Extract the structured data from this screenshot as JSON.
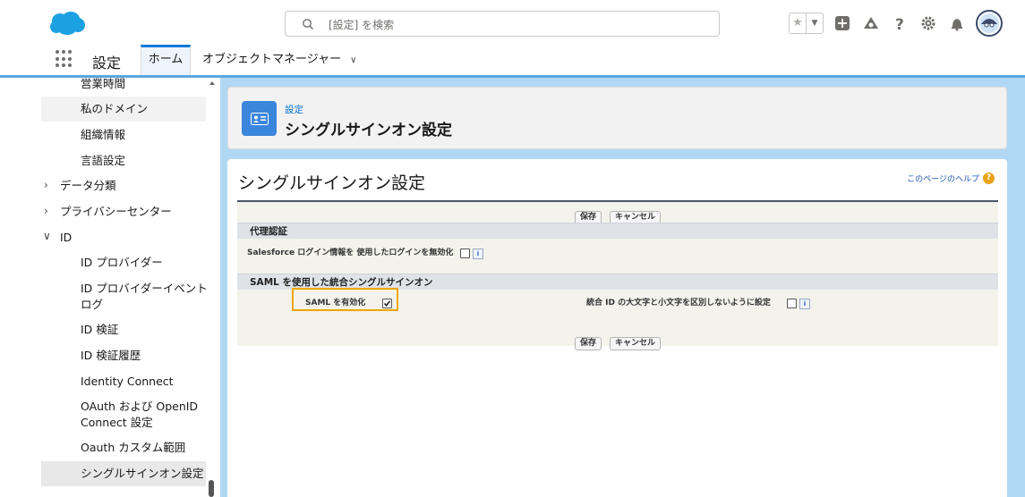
{
  "header": {
    "search_placeholder": "[設定] を検索",
    "icons": [
      "salesforce-cloud-logo",
      "search-icon",
      "favorite-star-icon",
      "favorites-dropdown-icon",
      "global-add-icon",
      "trailhead-icon",
      "help-icon",
      "setup-gear-icon",
      "notification-bell-icon",
      "user-avatar"
    ],
    "brand_color": "#1ba1e2"
  },
  "nav": {
    "app_name": "設定",
    "tabs": [
      {
        "label": "ホーム"
      },
      {
        "label": "オブジェクトマネージャー"
      }
    ]
  },
  "sidebar": {
    "items": [
      {
        "label": "営業時間"
      },
      {
        "label": "私のドメイン"
      },
      {
        "label": "組織情報"
      },
      {
        "label": "言語設定"
      },
      {
        "label": "データ分類"
      },
      {
        "label": "プライバシーセンター"
      },
      {
        "label": "ID"
      },
      {
        "label": "ID プロバイダー"
      },
      {
        "label": "ID プロバイダーイベント"
      },
      {
        "label": "ログ"
      },
      {
        "label": "ID 検証"
      },
      {
        "label": "ID 検証履歴"
      },
      {
        "label": "Identity Connect"
      },
      {
        "label": "OAuth および OpenID"
      },
      {
        "label": "Connect 設定"
      },
      {
        "label": "Oauth カスタム範囲"
      },
      {
        "label": "シングルサインオン設定"
      }
    ]
  },
  "page_header": {
    "breadcrumb": "設定",
    "title": "シングルサインオン設定"
  },
  "panel": {
    "title": "シングルサインオン設定",
    "help_link": "このページのヘルプ",
    "buttons": {
      "save": "保存",
      "cancel": "キャンセル"
    },
    "sections": {
      "delegated": "代理認証",
      "saml": "SAML を使用した統合シングルサインオン"
    },
    "fields": {
      "disable_login": "Salesforce ログイン情報を 使用したログインを無効化",
      "saml_enabled": "SAML を有効化",
      "case_insensitive": "統合 ID の大文字と小文字を区別しないように設定"
    },
    "values": {
      "disable_login": false,
      "saml_enabled": true,
      "case_insensitive": false
    },
    "info_glyph": "i"
  }
}
